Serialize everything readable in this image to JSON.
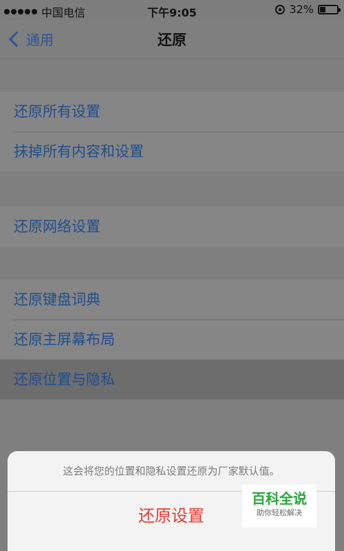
{
  "status": {
    "carrier": "中国电信",
    "time": "下午9:05",
    "battery": "32%",
    "battery_level": 0.32,
    "signal_dots": 5
  },
  "nav": {
    "back_label": "通用",
    "title": "还原"
  },
  "groups": [
    {
      "items": [
        "还原所有设置",
        "抹掉所有内容和设置"
      ]
    },
    {
      "items": [
        "还原网络设置"
      ]
    },
    {
      "items": [
        "还原键盘词典",
        "还原主屏幕布局",
        "还原位置与隐私"
      ]
    }
  ],
  "sheet": {
    "message": "这会将您的位置和隐私设置还原为厂家默认值。",
    "action_label": "还原设置"
  },
  "watermark": {
    "title": "百科全说",
    "subtitle": "助你轻松解决"
  }
}
